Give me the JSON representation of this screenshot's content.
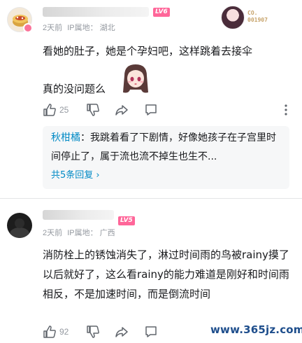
{
  "comments": [
    {
      "level": "LV6",
      "time": "2天前",
      "ip_label": "IP属地：",
      "ip_location": "湖北",
      "content_line1": "看她的肚子，她是个孕妇吧，这样跳着去接伞",
      "content_line2": "真的没问题么",
      "likes": "25",
      "badge_text_line1": "CO.",
      "badge_text_line2": "001907",
      "reply_preview": {
        "user": "秋柑橘",
        "text": "：我跳着看了下剧情，好像她孩子在子宫里时间停止了，属于流也流不掉生也生不...",
        "more": "共5条回复 ›"
      }
    },
    {
      "level": "LV5",
      "time": "2天前",
      "ip_label": "IP属地：",
      "ip_location": "广西",
      "content": "消防栓上的锈蚀消失了，淋过时间雨的鸟被rainy摸了以后就好了，这么看rainy的能力难道是刚好和时间雨相反，不是加速时间，而是倒流时间",
      "likes": "92"
    }
  ],
  "watermark": "www.365jz.com",
  "icons": {
    "like": "thumbs-up-icon",
    "dislike": "thumbs-down-icon",
    "share": "share-icon",
    "reply": "comment-icon",
    "more": "more-vertical-icon"
  },
  "colors": {
    "level_badge": "#ff6699",
    "link_blue": "#008ac5",
    "meta_gray": "#9499a0"
  }
}
